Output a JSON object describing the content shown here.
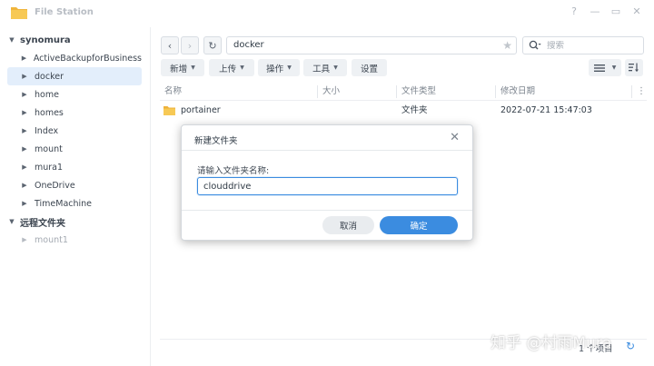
{
  "window": {
    "title": "File Station",
    "controls": {
      "help": "?",
      "minimize": "—",
      "maximize": "▭",
      "close": "✕"
    }
  },
  "sidebar": {
    "root": "synomura",
    "items": [
      "ActiveBackupforBusiness",
      "docker",
      "home",
      "homes",
      "Index",
      "mount",
      "mura1",
      "OneDrive",
      "TimeMachine"
    ],
    "selected": "docker",
    "remote_root": "远程文件夹",
    "remote_items": [
      "mount1"
    ]
  },
  "toolbar": {
    "path": "docker",
    "search_placeholder": "搜索",
    "buttons": {
      "create": "新增",
      "upload": "上传",
      "action": "操作",
      "tools": "工具",
      "settings": "设置"
    }
  },
  "file_list": {
    "columns": {
      "name": "名称",
      "size": "大小",
      "type": "文件类型",
      "modified": "修改日期"
    },
    "rows": [
      {
        "name": "portainer",
        "size": "",
        "type": "文件夹",
        "modified": "2022-07-21 15:47:03"
      }
    ]
  },
  "status": {
    "count": "1 个项目"
  },
  "watermark": "知乎 @村雨Mura",
  "dialog": {
    "title": "新建文件夹",
    "label": "请输入文件夹名称:",
    "input_value": "clouddrive",
    "cancel": "取消",
    "ok": "确定"
  },
  "colors": {
    "accent": "#3b8ce0",
    "folder": "#f5c04a",
    "selected_row": "#e3eefb"
  },
  "icons": [
    "folder-icon",
    "chevron-left-icon",
    "chevron-right-icon",
    "refresh-icon",
    "star-icon",
    "search-icon",
    "list-view-icon",
    "sort-icon",
    "more-vertical-icon",
    "close-icon"
  ]
}
